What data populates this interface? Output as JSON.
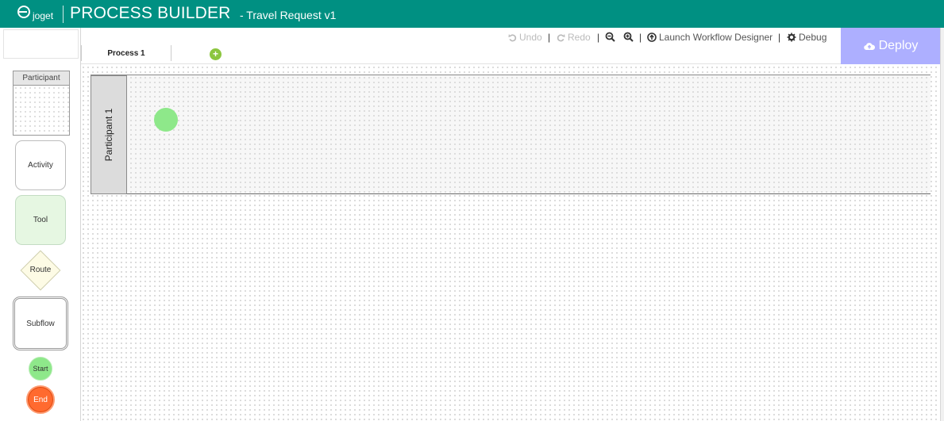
{
  "header": {
    "logo_text": "joget",
    "title": "PROCESS BUILDER",
    "subtitle": "- Travel Request v1",
    "background": "#009082"
  },
  "palette": {
    "participant_label": "Participant",
    "activity_label": "Activity",
    "tool_label": "Tool",
    "route_label": "Route",
    "subflow_label": "Subflow",
    "start_label": "Start",
    "end_label": "End"
  },
  "toolbar": {
    "undo_label": "Undo",
    "redo_label": "Redo",
    "separator": "|",
    "launch_label": "Launch Workflow Designer",
    "debug_label": "Debug",
    "icons": [
      "undo-icon",
      "redo-icon",
      "zoom-out-icon",
      "zoom-in-icon",
      "launch-icon",
      "gear-icon"
    ]
  },
  "tabs": {
    "items": [
      {
        "label": "Process 1"
      }
    ],
    "add_label": "+"
  },
  "deploy": {
    "label": "Deploy",
    "icon": "cloud-upload-icon",
    "background": "#adafff"
  },
  "canvas": {
    "lane_label": "Participant 1",
    "start_node_color": "#8ee88a"
  }
}
